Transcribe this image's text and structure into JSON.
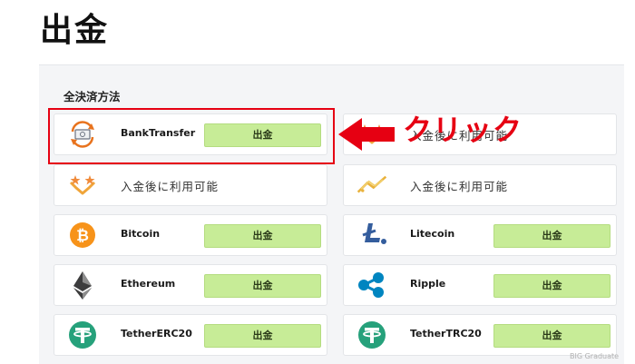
{
  "page": {
    "title": "出金"
  },
  "section": {
    "label": "全決済方法"
  },
  "withdraw_label": "出金",
  "available_after_deposit": "入金後に利用可能",
  "methods": [
    {
      "name": "BankTransfer",
      "icon": "bank-transfer-icon"
    },
    {
      "name": "",
      "icon": "sticpay-icon"
    },
    {
      "name": "",
      "icon": "bitwallet-icon"
    },
    {
      "name": "Bitcoin",
      "icon": "bitcoin-icon"
    },
    {
      "name": "Litecoin",
      "icon": "litecoin-icon"
    },
    {
      "name": "Ethereum",
      "icon": "ethereum-icon"
    },
    {
      "name": "Ripple",
      "icon": "ripple-icon"
    },
    {
      "name": "TetherERC20",
      "icon": "tether-icon"
    },
    {
      "name": "TetherTRC20",
      "icon": "tether-icon"
    }
  ],
  "annotation": {
    "text": "クリック",
    "color": "#e60012"
  },
  "colors": {
    "button": "#c7ec97",
    "bitcoin": "#f7931a",
    "litecoin": "#345d9d",
    "ripple": "#0085c0",
    "tether": "#26a17b"
  },
  "watermark": "BIG Graduate"
}
